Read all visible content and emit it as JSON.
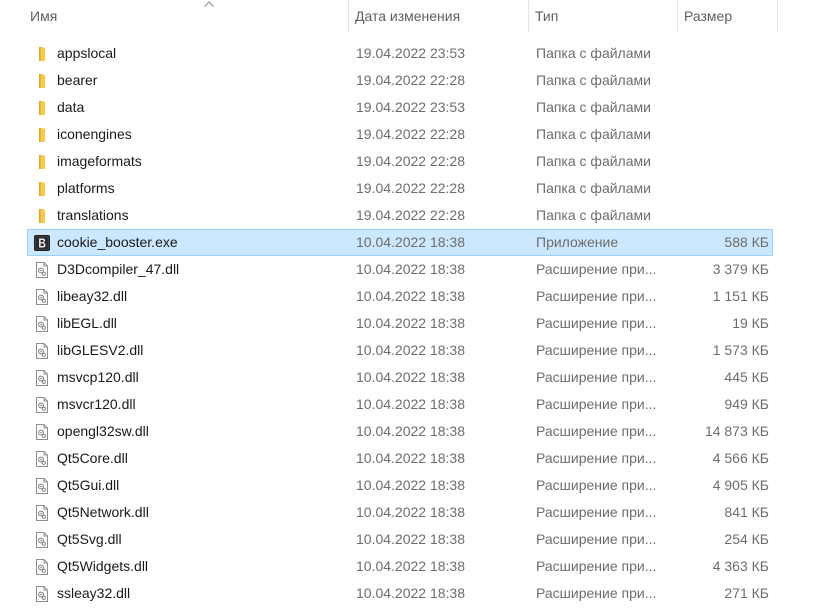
{
  "columns": {
    "name": "Имя",
    "date": "Дата изменения",
    "type": "Тип",
    "size": "Размер"
  },
  "sort": {
    "column": "name",
    "direction": "ascending",
    "indicator_icon": "sort-up-icon"
  },
  "colors": {
    "folder": "#f8c849",
    "folder_dark": "#e0a91f",
    "selection_bg": "#cce8ff",
    "selection_border": "#99d1ff"
  },
  "files": [
    {
      "name": "appslocal",
      "date": "19.04.2022 23:53",
      "type": "Папка с файлами",
      "size": "",
      "icon": "folder-icon"
    },
    {
      "name": "bearer",
      "date": "19.04.2022 22:28",
      "type": "Папка с файлами",
      "size": "",
      "icon": "folder-icon"
    },
    {
      "name": "data",
      "date": "19.04.2022 23:53",
      "type": "Папка с файлами",
      "size": "",
      "icon": "folder-icon"
    },
    {
      "name": "iconengines",
      "date": "19.04.2022 22:28",
      "type": "Папка с файлами",
      "size": "",
      "icon": "folder-icon"
    },
    {
      "name": "imageformats",
      "date": "19.04.2022 22:28",
      "type": "Папка с файлами",
      "size": "",
      "icon": "folder-icon"
    },
    {
      "name": "platforms",
      "date": "19.04.2022 22:28",
      "type": "Папка с файлами",
      "size": "",
      "icon": "folder-icon"
    },
    {
      "name": "translations",
      "date": "19.04.2022 22:28",
      "type": "Папка с файлами",
      "size": "",
      "icon": "folder-icon"
    },
    {
      "name": "cookie_booster.exe",
      "date": "10.04.2022 18:38",
      "type": "Приложение",
      "size": "588 КБ",
      "icon": "app-icon",
      "selected": true
    },
    {
      "name": "D3Dcompiler_47.dll",
      "date": "10.04.2022 18:38",
      "type": "Расширение при...",
      "size": "3 379 КБ",
      "icon": "dll-icon"
    },
    {
      "name": "libeay32.dll",
      "date": "10.04.2022 18:38",
      "type": "Расширение при...",
      "size": "1 151 КБ",
      "icon": "dll-icon"
    },
    {
      "name": "libEGL.dll",
      "date": "10.04.2022 18:38",
      "type": "Расширение при...",
      "size": "19 КБ",
      "icon": "dll-icon"
    },
    {
      "name": "libGLESV2.dll",
      "date": "10.04.2022 18:38",
      "type": "Расширение при...",
      "size": "1 573 КБ",
      "icon": "dll-icon"
    },
    {
      "name": "msvcp120.dll",
      "date": "10.04.2022 18:38",
      "type": "Расширение при...",
      "size": "445 КБ",
      "icon": "dll-icon"
    },
    {
      "name": "msvcr120.dll",
      "date": "10.04.2022 18:38",
      "type": "Расширение при...",
      "size": "949 КБ",
      "icon": "dll-icon"
    },
    {
      "name": "opengl32sw.dll",
      "date": "10.04.2022 18:38",
      "type": "Расширение при...",
      "size": "14 873 КБ",
      "icon": "dll-icon"
    },
    {
      "name": "Qt5Core.dll",
      "date": "10.04.2022 18:38",
      "type": "Расширение при...",
      "size": "4 566 КБ",
      "icon": "dll-icon"
    },
    {
      "name": "Qt5Gui.dll",
      "date": "10.04.2022 18:38",
      "type": "Расширение при...",
      "size": "4 905 КБ",
      "icon": "dll-icon"
    },
    {
      "name": "Qt5Network.dll",
      "date": "10.04.2022 18:38",
      "type": "Расширение при...",
      "size": "841 КБ",
      "icon": "dll-icon"
    },
    {
      "name": "Qt5Svg.dll",
      "date": "10.04.2022 18:38",
      "type": "Расширение при...",
      "size": "254 КБ",
      "icon": "dll-icon"
    },
    {
      "name": "Qt5Widgets.dll",
      "date": "10.04.2022 18:38",
      "type": "Расширение при...",
      "size": "4 363 КБ",
      "icon": "dll-icon"
    },
    {
      "name": "ssleay32.dll",
      "date": "10.04.2022 18:38",
      "type": "Расширение при...",
      "size": "271 КБ",
      "icon": "dll-icon"
    }
  ]
}
